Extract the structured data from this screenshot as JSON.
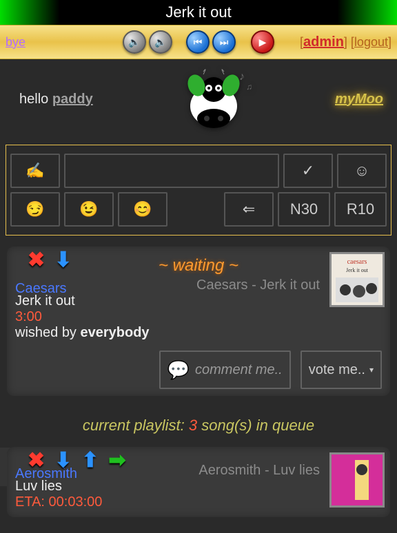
{
  "header": {
    "title": "Jerk it out",
    "bye": "bye"
  },
  "auth": {
    "admin": "admin",
    "logout": "logout"
  },
  "welcome": {
    "hello": "hello ",
    "user": "paddy",
    "myMoo": "myMoo"
  },
  "compose": {
    "emoji_write": "✍️",
    "check": "✓",
    "smile_outline": "☺",
    "smirk": "😏",
    "wink": "😉",
    "blush": "😊",
    "back": "⇐",
    "n30": "N30",
    "r10": "R10",
    "input_value": ""
  },
  "now": {
    "status": "~ waiting ~",
    "artist": "Caesars",
    "title": "Jerk it out",
    "time": "3:00",
    "wished_prefix": "wished by ",
    "wisher": "everybody",
    "desc": "Caesars - Jerk it out",
    "comment_placeholder": "comment me..",
    "vote_label": "vote me.."
  },
  "playlist": {
    "heading_pre": "current playlist: ",
    "count": "3",
    "heading_post": " song(s) in queue"
  },
  "queue2": {
    "artist": "Aerosmith",
    "title": "Luv lies",
    "eta": "ETA: 00:03:00",
    "desc": "Aerosmith - Luv lies"
  },
  "chart_data": null
}
